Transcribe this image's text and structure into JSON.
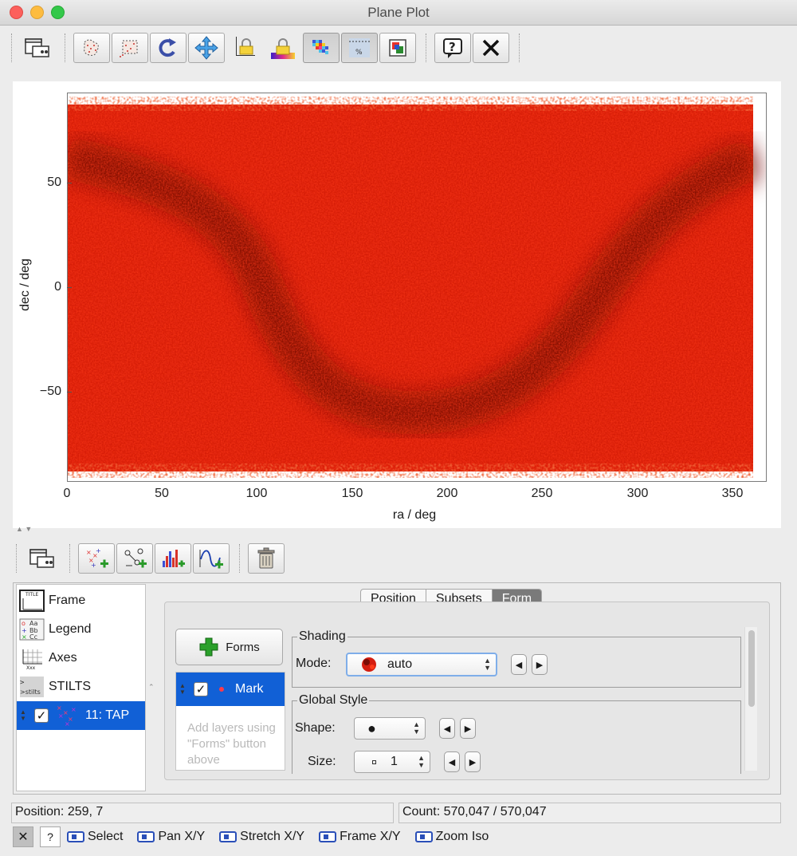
{
  "window": {
    "title": "Plane Plot"
  },
  "toolbar": {
    "icons": [
      "window-icon",
      "blob-subset-icon",
      "box-subset-icon",
      "replot-icon",
      "navigate-icon",
      "lock-axes-icon",
      "lock-aux-icon",
      "density-icon",
      "legend-icon",
      "export-icon",
      "help-icon",
      "close-icon"
    ]
  },
  "plot": {
    "xlabel": "ra / deg",
    "ylabel": "dec / deg",
    "xticks": [
      "0",
      "50",
      "100",
      "150",
      "200",
      "250",
      "300",
      "350"
    ],
    "yticks": [
      "50",
      "0",
      "−50"
    ],
    "colors": {
      "base": "#e0210a",
      "dark": "#7a0d06",
      "bright": "#ff3b1a"
    }
  },
  "layer_toolbar": {
    "icons": [
      "window-icon",
      "add-position-layer-icon",
      "add-pair-layer-icon",
      "add-histogram-layer-icon",
      "add-function-layer-icon",
      "delete-layer-icon"
    ]
  },
  "layers": {
    "items": [
      {
        "label": "Frame",
        "icon": "frame-icon"
      },
      {
        "label": "Legend",
        "icon": "legend-icon"
      },
      {
        "label": "Axes",
        "icon": "axes-icon"
      },
      {
        "label": "STILTS",
        "icon": "stilts-icon"
      }
    ],
    "selected": {
      "label": "11: TAP",
      "checked": true
    }
  },
  "tabs": [
    {
      "label": "Position",
      "active": false
    },
    {
      "label": "Subsets",
      "active": false
    },
    {
      "label": "Form",
      "active": true
    }
  ],
  "forms": {
    "button_label": "Forms",
    "item_label": "Mark",
    "hint": "Add layers using \"Forms\" button above"
  },
  "shading": {
    "legend": "Shading",
    "mode_label": "Mode:",
    "mode_value": "auto"
  },
  "global_style": {
    "legend": "Global Style",
    "shape_label": "Shape:",
    "shape_value": "●",
    "size_label": "Size:",
    "size_value": "1"
  },
  "status": {
    "position": "Position: 259, 7",
    "count": "Count: 570,047 / 570,047"
  },
  "mouse_actions": [
    "Select",
    "Pan X/Y",
    "Stretch X/Y",
    "Frame X/Y",
    "Zoom Iso"
  ]
}
